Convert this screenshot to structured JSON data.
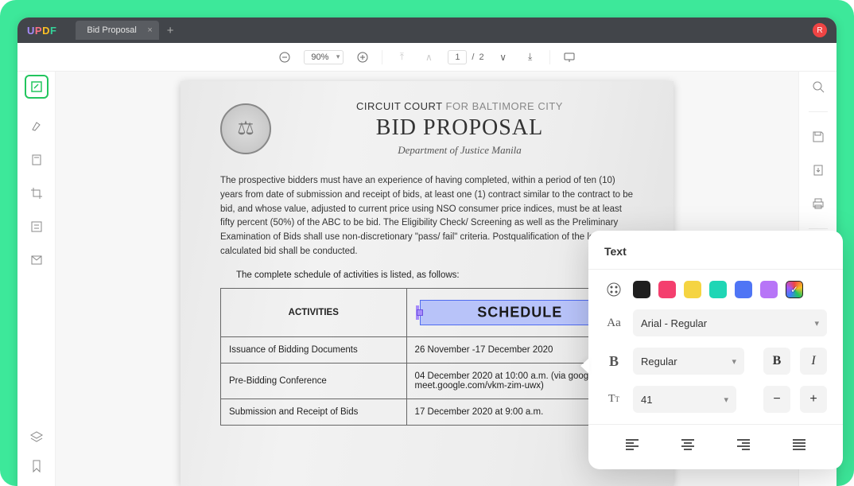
{
  "app": {
    "logo_letters": [
      "U",
      "P",
      "D",
      "F"
    ],
    "tab_name": "Bid Proposal",
    "avatar_initial": "R"
  },
  "toolbar": {
    "zoom": "90%",
    "page_current": "1",
    "page_total": "2"
  },
  "document": {
    "court_line_a": "CIRCUIT COURT ",
    "court_line_b": "FOR BALTIMORE CITY",
    "title": "BID PROPOSAL",
    "dept": "Department of Justice Manila",
    "paragraph": "The prospective bidders must have an experience of having completed, within a period of ten (10) years from date of submission and receipt of bids, at least one (1) contract similar to the contract to be bid, and whose value, adjusted to current price using NSO consumer price indices, must be at least fifty percent (50%) of the ABC to be bid. The Eligibility Check/ Screening as well as the Preliminary Examination of Bids shall use non-discretionary \"pass/ fail\" criteria. Postqualification of the lowest calculated bid shall be conducted.",
    "sched_intro": "The complete schedule of activities is listed, as follows:",
    "table": {
      "head_activities": "ACTIVITIES",
      "head_schedule": "SCHEDULE",
      "rows": [
        {
          "activity": "Issuance of Bidding Documents",
          "schedule": "26 November -17 December 2020"
        },
        {
          "activity": "Pre-Bidding Conference",
          "schedule": "04 December 2020 at 10:00 a.m. (via google meet - meet.google.com/vkm-zim-uwx)"
        },
        {
          "activity": "Submission and Receipt of Bids",
          "schedule": "17 December 2020 at 9:00 a.m."
        }
      ]
    }
  },
  "text_panel": {
    "title": "Text",
    "colors": {
      "black": "#1f1f1f",
      "pink": "#f43f6e",
      "yellow": "#f5d442",
      "teal": "#1fd6b5",
      "blue": "#4f75f5",
      "purple": "#b775f7"
    },
    "font": "Arial - Regular",
    "weight": "Regular",
    "size": "41",
    "bold_label": "B",
    "italic_label": "I"
  }
}
